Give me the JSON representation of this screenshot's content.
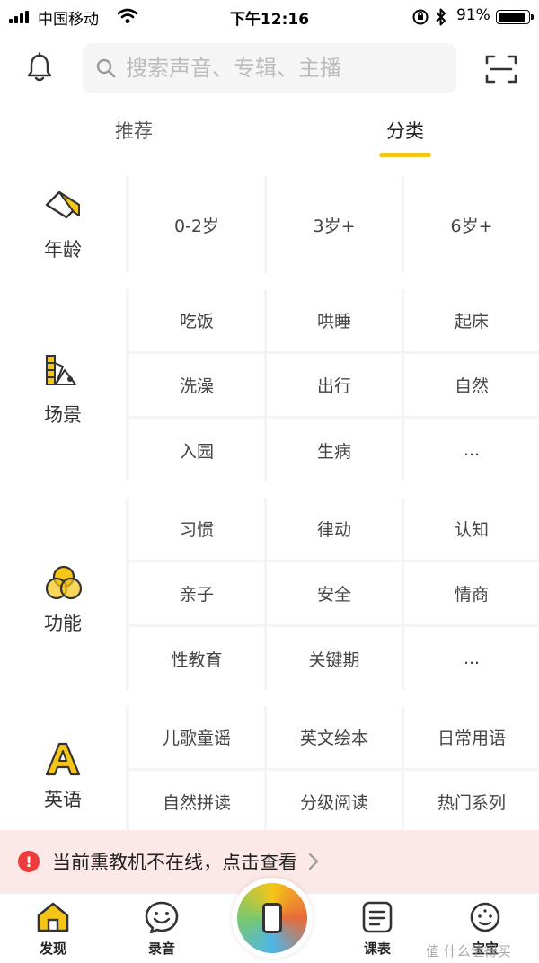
{
  "status_bar": {
    "carrier": "中国移动",
    "time": "下午12:16",
    "battery": "91%"
  },
  "search": {
    "placeholder": "搜索声音、专辑、主播"
  },
  "tabs": [
    {
      "label": "推荐",
      "active": false
    },
    {
      "label": "分类",
      "active": true
    }
  ],
  "accent_color": "#f5c518",
  "categories": [
    {
      "label": "年龄",
      "icon": "paint-bucket-icon",
      "items": [
        "0-2岁",
        "3岁+",
        "6岁+"
      ]
    },
    {
      "label": "场景",
      "icon": "palette-icon",
      "items": [
        "吃饭",
        "哄睡",
        "起床",
        "洗澡",
        "出行",
        "自然",
        "入园",
        "生病",
        "..."
      ]
    },
    {
      "label": "功能",
      "icon": "venn-circles-icon",
      "items": [
        "习惯",
        "律动",
        "认知",
        "亲子",
        "安全",
        "情商",
        "性教育",
        "关键期",
        "..."
      ]
    },
    {
      "label": "英语",
      "icon": "letter-a-icon",
      "items": [
        "儿歌童谣",
        "英文绘本",
        "日常用语",
        "自然拼读",
        "分级阅读",
        "热门系列"
      ]
    }
  ],
  "banner": {
    "text": "当前熏教机不在线，点击查看",
    "icon": "!"
  },
  "bottom_nav": [
    {
      "label": "发现",
      "icon": "home-icon"
    },
    {
      "label": "录音",
      "icon": "smile-chat-icon"
    },
    {
      "label": "",
      "icon": "device-center-icon"
    },
    {
      "label": "课表",
      "icon": "schedule-icon"
    },
    {
      "label": "宝宝",
      "icon": "baby-face-icon"
    }
  ],
  "watermark": "值 什么值得买"
}
